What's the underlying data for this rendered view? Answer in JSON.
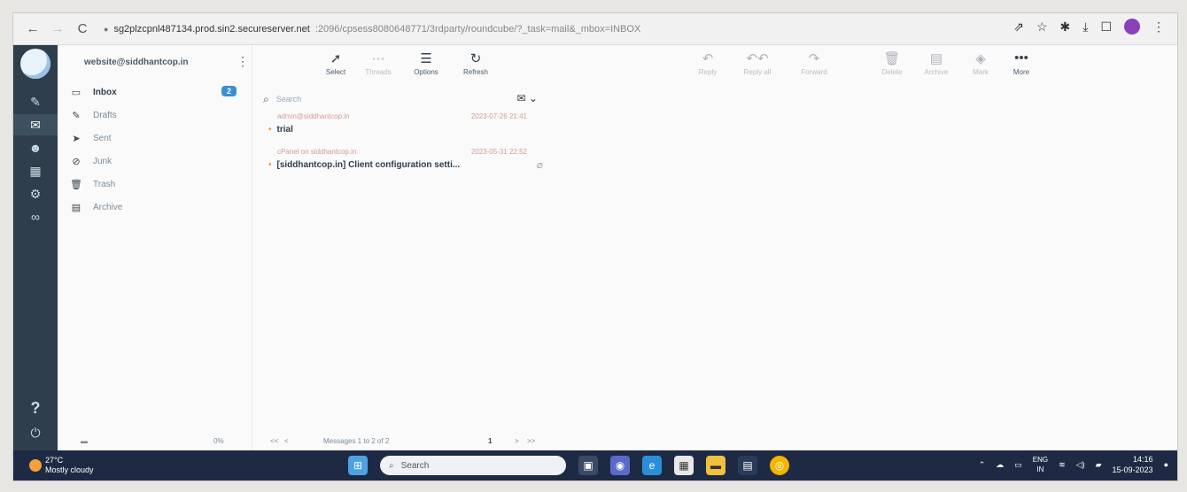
{
  "browser": {
    "url_host": "sg2plzcpnl487134.prod.sin2.secureserver.net",
    "url_path": ":2096/cpsess8080648771/3rdparty/roundcube/?_task=mail&_mbox=INBOX",
    "icons": [
      "back-arrow",
      "forward-arrow",
      "reload",
      "lock",
      "share",
      "star",
      "extensions",
      "download",
      "window",
      "profile",
      "menu"
    ]
  },
  "account": {
    "email": "website@siddhantcop.in"
  },
  "folders": [
    {
      "label": "Inbox",
      "icon": "inbox",
      "badge": "2",
      "selected": true
    },
    {
      "label": "Drafts",
      "icon": "pencil"
    },
    {
      "label": "Sent",
      "icon": "paper-plane"
    },
    {
      "label": "Junk",
      "icon": "ban"
    },
    {
      "label": "Trash",
      "icon": "trash"
    },
    {
      "label": "Archive",
      "icon": "archive"
    }
  ],
  "toolbar": {
    "select": "Select",
    "threads": "Threads",
    "options": "Options",
    "refresh": "Refresh",
    "reply": "Reply",
    "reply_all": "Reply all",
    "forward": "Forward",
    "delete": "Delete",
    "archive": "Archive",
    "mark": "Mark",
    "more": "More"
  },
  "search": {
    "placeholder": "Search"
  },
  "messages": [
    {
      "from": "admin@siddhantcop.in",
      "date": "2023-07-26 21:41",
      "subject": "trial",
      "attachment": false
    },
    {
      "from": "cPanel on siddhantcop.in",
      "date": "2023-05-31 22:52",
      "subject": "[siddhantcop.in] Client configuration setti...",
      "attachment": true
    }
  ],
  "footer": {
    "quota": "0%",
    "messages": "Messages 1 to 2 of 2",
    "page": "1",
    "first": "<<",
    "prev": "<",
    "next": ">",
    "last": ">>"
  },
  "taskbar": {
    "temperature": "27°C",
    "weather": "Mostly cloudy",
    "search_placeholder": "Search",
    "lang_top": "ENG",
    "lang_bottom": "IN",
    "time": "14:16",
    "date": "15-09-2023"
  },
  "colors": {
    "rail": "#2f3e4d",
    "accent": "#3b8ecf",
    "taskbar": "#1e2a44"
  }
}
